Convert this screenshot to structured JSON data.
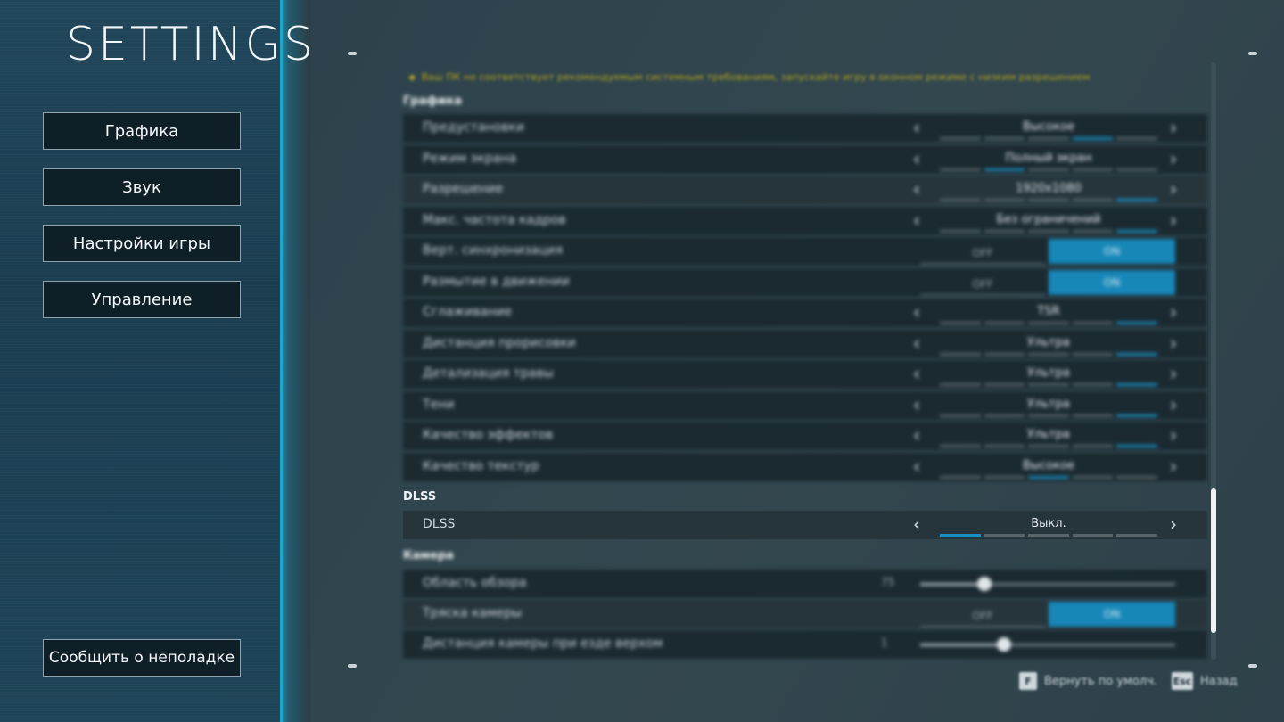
{
  "title": "SETTINGS",
  "sidebar": {
    "items": [
      {
        "label": "Графика"
      },
      {
        "label": "Звук"
      },
      {
        "label": "Настройки игры"
      },
      {
        "label": "Управление"
      }
    ],
    "report_label": "Сообщить о неполадке"
  },
  "warning": "Ваш ПК не соответствует рекомендуемым системным требованиям, запускайте игру в оконном режиме с низким разрешением",
  "sections": {
    "graphics": "Графика",
    "dlss": "DLSS",
    "camera": "Камера"
  },
  "graphics_rows": [
    {
      "label": "Предустановки",
      "value": "Высокое"
    },
    {
      "label": "Режим экрана",
      "value": "Полный экран"
    },
    {
      "label": "Разрешение",
      "value": "1920x1080"
    },
    {
      "label": "Макс. частота кадров",
      "value": "Без ограничений"
    },
    {
      "label": "Верт. синхронизация",
      "off": "OFF",
      "on": "ON"
    },
    {
      "label": "Размытие в движении",
      "off": "OFF",
      "on": "ON"
    },
    {
      "label": "Сглаживание",
      "value": "TSR"
    },
    {
      "label": "Дистанция прорисовки",
      "value": "Ультра"
    },
    {
      "label": "Детализация травы",
      "value": "Ультра"
    },
    {
      "label": "Тени",
      "value": "Ультра"
    },
    {
      "label": "Качество эффектов",
      "value": "Ультра"
    },
    {
      "label": "Качество текстур",
      "value": "Высокое"
    }
  ],
  "dlss_row": {
    "label": "DLSS",
    "value": "Выкл."
  },
  "camera_rows": [
    {
      "label": "Область обзора",
      "value": "75"
    },
    {
      "label": "Тряска камеры",
      "off": "OFF",
      "on": "ON"
    },
    {
      "label": "Дистанция камеры при езде верхом",
      "value": "1"
    }
  ],
  "footer": {
    "reset_key": "F",
    "reset_label": "Вернуть по умолч.",
    "back_key": "Esc",
    "back_label": "Назад"
  },
  "colors": {
    "accent": "#1787b8",
    "sidebar": "#1b3d50",
    "row_bg": "#1b2a31"
  }
}
